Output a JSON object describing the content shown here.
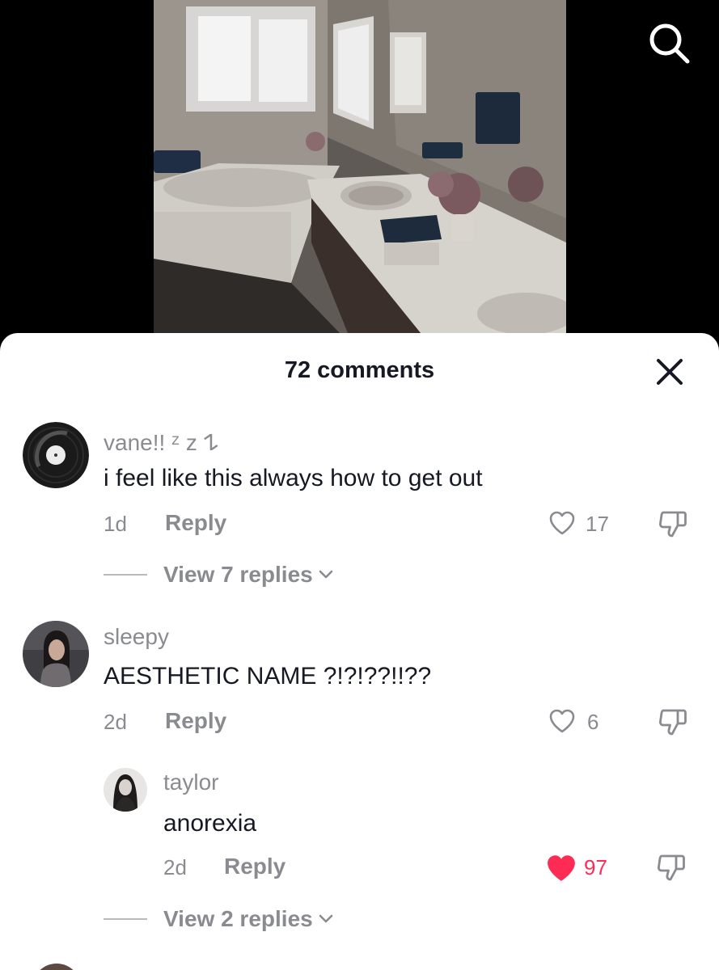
{
  "header": {
    "comment_count_label": "72 comments"
  },
  "icons": {
    "search": "search-icon",
    "close": "close-icon",
    "like": "heart-icon",
    "dislike": "thumbs-down-icon",
    "expand": "chevron-down-icon"
  },
  "colors": {
    "liked_heart": "#fe2c55",
    "secondary_text": "#8a8b91",
    "primary_text": "#161823"
  },
  "comments": [
    {
      "username": "vane!! ᶻ z 𐰁",
      "text": "i feel like this always how to get out",
      "time": "1d",
      "reply_label": "Reply",
      "likes": "17",
      "liked": false,
      "view_replies_label": "View 7 replies"
    },
    {
      "username": "sleepy",
      "text": "AESTHETIC NAME ?!?!??!!??",
      "time": "2d",
      "reply_label": "Reply",
      "likes": "6",
      "liked": false,
      "replies": [
        {
          "username": "taylor",
          "text": "anorexia",
          "time": "2d",
          "reply_label": "Reply",
          "likes": "97",
          "liked": true
        }
      ],
      "view_replies_label": "View 2 replies"
    }
  ]
}
